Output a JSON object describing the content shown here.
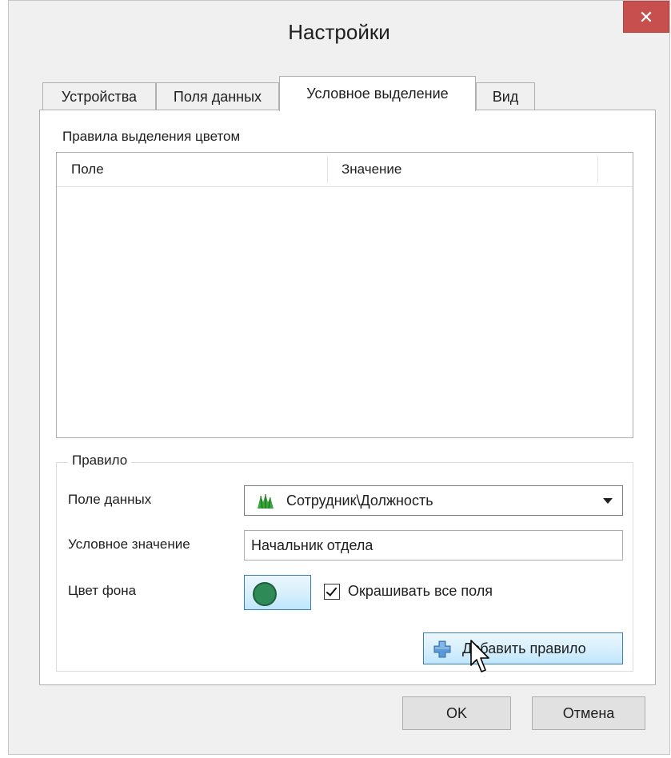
{
  "window": {
    "title": "Настройки",
    "close_symbol": "✕"
  },
  "tabs": [
    {
      "label": "Устройства",
      "active": false
    },
    {
      "label": "Поля данных",
      "active": false
    },
    {
      "label": "Условное выделение",
      "active": true
    },
    {
      "label": "Вид",
      "active": false
    }
  ],
  "rules": {
    "section_label": "Правила выделения цветом",
    "columns": [
      "Поле",
      "Значение"
    ],
    "rows": []
  },
  "rule": {
    "group_label": "Правило",
    "data_field_label": "Поле данных",
    "data_field_value": "Сотрудник\\Должность",
    "data_field_icon": "tree-field-icon",
    "conditional_value_label": "Условное значение",
    "conditional_value": "Начальник отдела",
    "bg_color_label": "Цвет фона",
    "bg_color": "#2e8a57",
    "color_all_fields_label": "Окрашивать все поля",
    "color_all_fields_checked": true,
    "add_button_label": "Добавить правило",
    "add_button_icon": "plus-icon"
  },
  "buttons": {
    "ok": "OK",
    "cancel": "Отмена"
  },
  "colors": {
    "close": "#c7504f",
    "accent": "#3c7fb1",
    "swatch": "#2e8a57"
  }
}
